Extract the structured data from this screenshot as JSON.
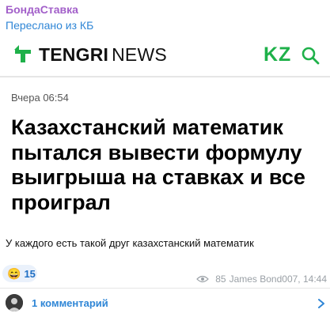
{
  "post": {
    "sender": "БондаСтавка",
    "forwarded_from": "Переслано из КБ"
  },
  "embed": {
    "logo_tengri": "TENGRI",
    "logo_news": "NEWS",
    "region": "KZ",
    "date": "Вчера 06:54",
    "headline": "Казахстанский математик пытался вывести формулу выигрыша на ставках и все проиграл"
  },
  "message": {
    "text": "У каждого есть такой друг казахстанский математик"
  },
  "reaction": {
    "emoji": "😄",
    "count": "15"
  },
  "meta": {
    "views": "85",
    "author_time": "James Bond007, 14:44"
  },
  "comments": {
    "label": "1 комментарий"
  },
  "colors": {
    "sender": "#a25fc9",
    "link": "#2f86d6",
    "brand_green": "#1fb14a"
  }
}
